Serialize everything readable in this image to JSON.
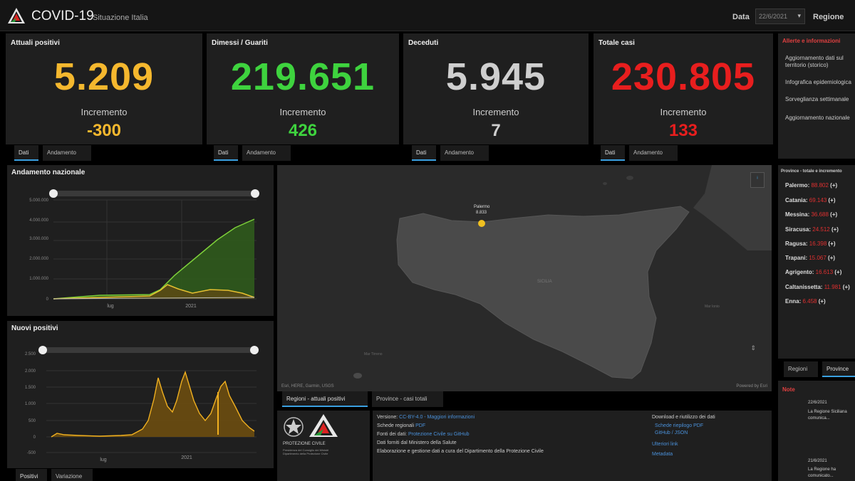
{
  "header": {
    "title": "COVID-19",
    "subtitle": "Situazione Italia",
    "date_label": "Data",
    "date_value": "22/6/2021",
    "region_label": "Regione"
  },
  "kpis": [
    {
      "title": "Attuali positivi",
      "value": "5.209",
      "inc_label": "Incremento",
      "inc": "-300",
      "color": "#f5b82e"
    },
    {
      "title": "Dimessi / Guariti",
      "value": "219.651",
      "inc_label": "Incremento",
      "inc": "426",
      "color": "#3ed33e"
    },
    {
      "title": "Deceduti",
      "value": "5.945",
      "inc_label": "Incremento",
      "inc": "7",
      "color": "#cfcfcf"
    },
    {
      "title": "Totale casi",
      "value": "230.805",
      "inc_label": "Incremento",
      "inc": "133",
      "color": "#e81e1e"
    }
  ],
  "kpi_tabs": [
    "Dati",
    "Andamento"
  ],
  "andamento": {
    "title": "Andamento nazionale",
    "y_ticks": [
      "5.000.000",
      "4.000.000",
      "3.000.000",
      "2.000.000",
      "1.000.000",
      "0"
    ],
    "x_ticks": [
      "lug",
      "2021"
    ]
  },
  "nuovi": {
    "title": "Nuovi positivi",
    "y_ticks": [
      "2.500",
      "2.000",
      "1.500",
      "1.000",
      "500",
      "0",
      "-500"
    ],
    "x_ticks": [
      "lug",
      "2021"
    ]
  },
  "bottom_tabs": [
    "Positivi",
    "Variazione"
  ],
  "map": {
    "label_top": "Palermo",
    "label_sub": "8.833",
    "sea_labels": [
      "Mar Tirreno",
      "Mar Ionio"
    ],
    "attribution": "Esri, HERE, Garmin, USGS",
    "powered": "Powered by Esri",
    "tabs": [
      "Regioni - attuali positivi",
      "Province - casi totali"
    ]
  },
  "info": {
    "lines": [
      {
        "label": "Versione: ",
        "text": "CC-BY-4.0 - Maggiori informazioni"
      },
      {
        "label": "Schede regionali ",
        "text": "PDF"
      },
      {
        "label": "Fonti dei dati: ",
        "text": "Protezione Civile su GitHub"
      },
      {
        "label": "",
        "text": "Dati forniti dal Ministero della Salute"
      },
      {
        "label": "",
        "text": "Elaborazione e gestione dati a cura del Dipartimento della Protezione Civile"
      }
    ],
    "links_title": "Download e riutilizzo dei dati",
    "links": [
      "Schede riepilogo PDF",
      "GitHub / JSON",
      "Ulteriori link",
      "Metadata"
    ],
    "logo_text": [
      "PROTEZIONE CIVILE",
      "Presidenza del Consiglio dei Ministri",
      "Dipartimento della Protezione Civile"
    ]
  },
  "sidebar": {
    "alerts_title": "Allerte e informazioni",
    "alerts": [
      "Aggiornamento dati sul territorio (storico)",
      "Infografica epidemiologica",
      "Sorveglianza settimanale",
      "Aggiornamento nazionale"
    ],
    "province_title": "Province - totale e incremento",
    "provinces": [
      {
        "name": "Palermo",
        "value": "88.802",
        "inc": "(+)"
      },
      {
        "name": "Catania",
        "value": "69.143",
        "inc": "(+)"
      },
      {
        "name": "Messina",
        "value": "36.688",
        "inc": "(+)"
      },
      {
        "name": "Siracusa",
        "value": "24.512",
        "inc": "(+)"
      },
      {
        "name": "Ragusa",
        "value": "16.398",
        "inc": "(+)"
      },
      {
        "name": "Trapani",
        "value": "15.067",
        "inc": "(+)"
      },
      {
        "name": "Agrigento",
        "value": "16.613",
        "inc": "(+)"
      },
      {
        "name": "Caltanissetta",
        "value": "11.981",
        "inc": "(+)"
      },
      {
        "name": "Enna",
        "value": "6.458",
        "inc": "(+)"
      }
    ],
    "tabs": [
      "Regioni",
      "Province"
    ],
    "notes_title": "Note",
    "notes": [
      {
        "date": "22/6/2021",
        "text": "La Regione Siciliana comunica..."
      },
      {
        "date": "21/6/2021",
        "text": "La Regione ha comunicato..."
      }
    ]
  }
}
